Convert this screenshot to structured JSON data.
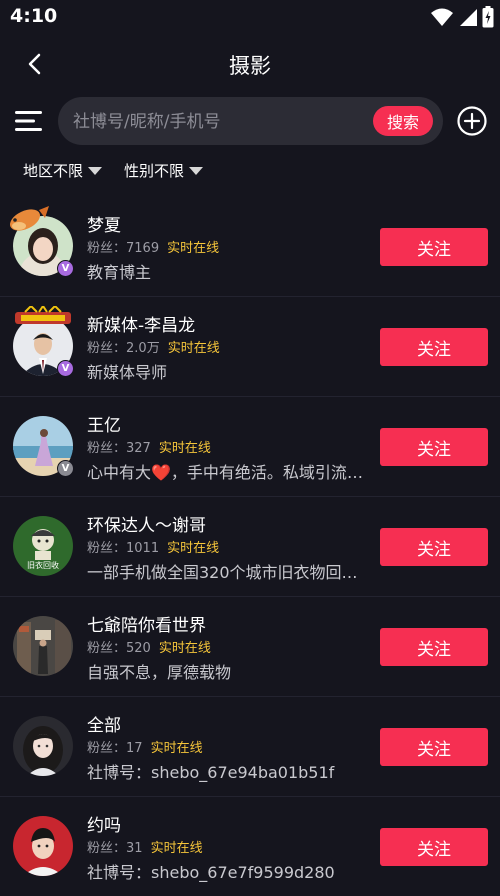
{
  "status_bar": {
    "time": "4:10"
  },
  "header": {
    "title": "摄影"
  },
  "search": {
    "placeholder": "社博号/昵称/手机号",
    "button_label": "搜索"
  },
  "filters": [
    {
      "label": "地区不限"
    },
    {
      "label": "性别不限"
    }
  ],
  "fans_label": "粉丝：",
  "users": [
    {
      "name": "梦夏",
      "fans_count": "7169",
      "online_label": "实时在线",
      "description": "教育博主",
      "follow_label": "关注",
      "badge": "V"
    },
    {
      "name": "新媒体-李昌龙",
      "fans_count": "2.0万",
      "online_label": "实时在线",
      "description": "新媒体导师",
      "follow_label": "关注",
      "badge": "V"
    },
    {
      "name": "王亿",
      "fans_count": "327",
      "online_label": "实时在线",
      "description": "心中有大❤️，手中有绝活。私域引流，…",
      "follow_label": "关注",
      "badge": "V"
    },
    {
      "name": "环保达人～谢哥",
      "fans_count": "1011",
      "online_label": "实时在线",
      "description": "一部手机做全国320个城市旧衣物回收…",
      "follow_label": "关注",
      "badge": "",
      "avatar_text": "旧衣回收"
    },
    {
      "name": "七爺陪你看世界",
      "fans_count": "520",
      "online_label": "实时在线",
      "description": "自强不息，厚德载物",
      "follow_label": "关注",
      "badge": ""
    },
    {
      "name": "全部",
      "fans_count": "17",
      "online_label": "实时在线",
      "description": "社博号：shebo_67e94ba01b51f",
      "follow_label": "关注",
      "badge": ""
    },
    {
      "name": "约吗",
      "fans_count": "31",
      "online_label": "实时在线",
      "description": "社博号：shebo_67e7f9599d280",
      "follow_label": "关注",
      "badge": ""
    }
  ],
  "colors": {
    "background": "#15151e",
    "accent": "#f62f52",
    "online": "#f5c53a",
    "search_bg": "#2c2c35",
    "verified_purple": "#a86be0"
  }
}
